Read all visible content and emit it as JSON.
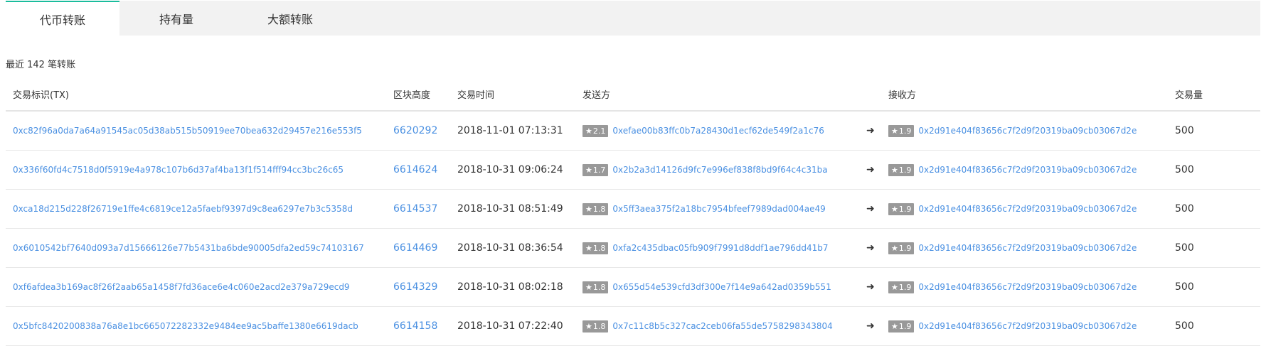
{
  "tabs": [
    {
      "label": "代币转账",
      "active": true
    },
    {
      "label": "持有量",
      "active": false
    },
    {
      "label": "大额转账",
      "active": false
    }
  ],
  "summary": "最近 142 笔转账",
  "columns": {
    "tx": "交易标识(TX)",
    "block": "区块高度",
    "time": "交易时间",
    "from": "发送方",
    "to": "接收方",
    "qty": "交易量"
  },
  "star_glyph": "★",
  "arrow_glyph": "➜",
  "rows": [
    {
      "tx": "0xc82f96a0da7a64a91545ac05d38ab515b50919ee70bea632d29457e216e553f5",
      "block": "6620292",
      "time": "2018-11-01 07:13:31",
      "from_score": "2.1",
      "from": "0xefae00b83ffc0b7a28430d1ecf62de549f2a1c76",
      "to_score": "1.9",
      "to": "0x2d91e404f83656c7f2d9f20319ba09cb03067d2e",
      "qty": "500"
    },
    {
      "tx": "0x336f60fd4c7518d0f5919e4a978c107b6d37af4ba13f1f514fff94cc3bc26c65",
      "block": "6614624",
      "time": "2018-10-31 09:06:24",
      "from_score": "1.7",
      "from": "0x2b2a3d14126d9fc7e996ef838f8bd9f64c4c31ba",
      "to_score": "1.9",
      "to": "0x2d91e404f83656c7f2d9f20319ba09cb03067d2e",
      "qty": "500"
    },
    {
      "tx": "0xca18d215d228f26719e1ffe4c6819ce12a5faebf9397d9c8ea6297e7b3c5358d",
      "block": "6614537",
      "time": "2018-10-31 08:51:49",
      "from_score": "1.8",
      "from": "0x5ff3aea375f2a18bc7954bfeef7989dad004ae49",
      "to_score": "1.9",
      "to": "0x2d91e404f83656c7f2d9f20319ba09cb03067d2e",
      "qty": "500"
    },
    {
      "tx": "0x6010542bf7640d093a7d15666126e77b5431ba6bde90005dfa2ed59c74103167",
      "block": "6614469",
      "time": "2018-10-31 08:36:54",
      "from_score": "1.8",
      "from": "0xfa2c435dbac05fb909f7991d8ddf1ae796dd41b7",
      "to_score": "1.9",
      "to": "0x2d91e404f83656c7f2d9f20319ba09cb03067d2e",
      "qty": "500"
    },
    {
      "tx": "0xf6afdea3b169ac8f26f2aab65a1458f7fd36ace6e4c060e2acd2e379a729ecd9",
      "block": "6614329",
      "time": "2018-10-31 08:02:18",
      "from_score": "1.8",
      "from": "0x655d54e539cfd3df300e7f14e9a642ad0359b551",
      "to_score": "1.9",
      "to": "0x2d91e404f83656c7f2d9f20319ba09cb03067d2e",
      "qty": "500"
    },
    {
      "tx": "0x5bfc8420200838a76a8e1bc665072282332e9484ee9ac5baffe1380e6619dacb",
      "block": "6614158",
      "time": "2018-10-31 07:22:40",
      "from_score": "1.8",
      "from": "0x7c11c8b5c327cac2ceb06fa55de5758298343804",
      "to_score": "1.9",
      "to": "0x2d91e404f83656c7f2d9f20319ba09cb03067d2e",
      "qty": "500"
    }
  ],
  "colors": {
    "link": "#4a90e2",
    "badge": "#999999",
    "tab_bar": "#f2f2f2",
    "tab_active_accent": "#1abc9c"
  }
}
